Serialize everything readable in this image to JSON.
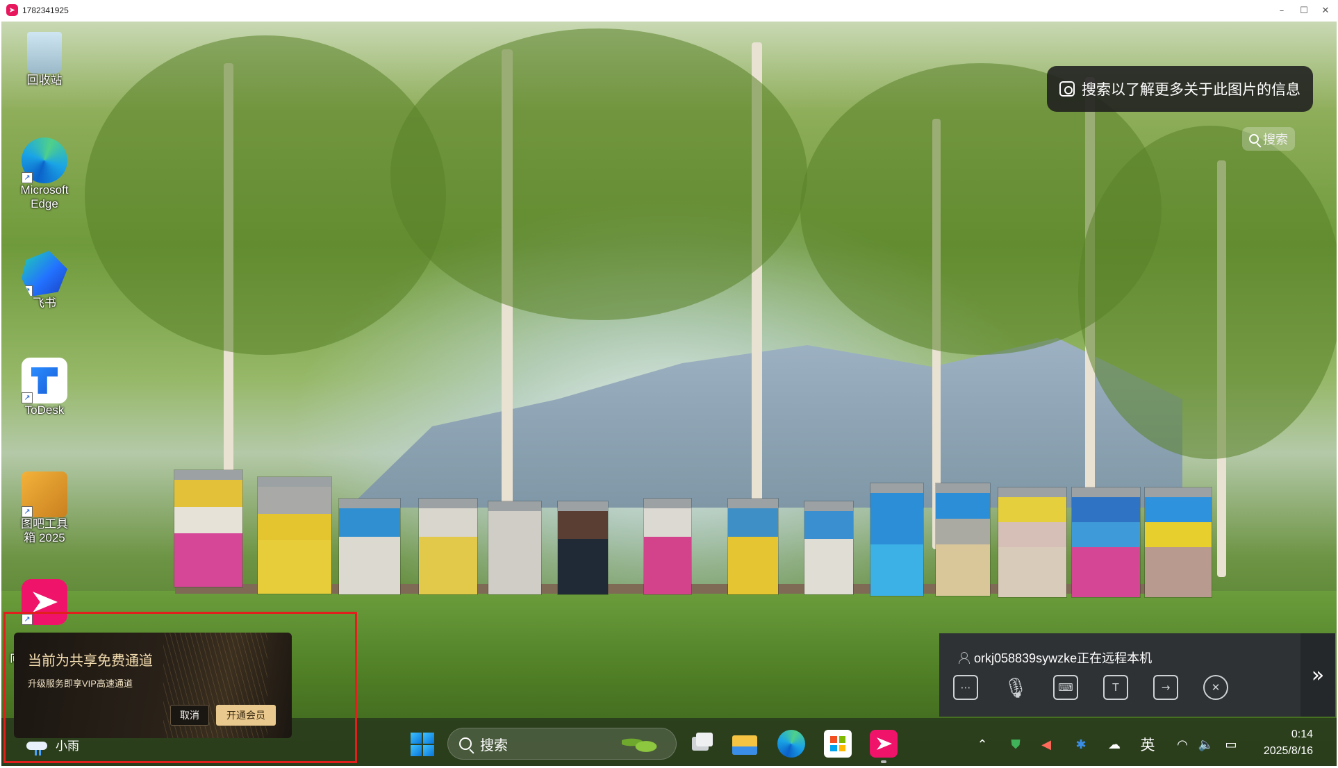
{
  "window": {
    "title": "1782341925",
    "controls": [
      "minimize-icon",
      "maximize-icon",
      "close-icon"
    ]
  },
  "desktop": {
    "icons": [
      {
        "label": "回收站",
        "icon": "recycle-bin-icon"
      },
      {
        "label": "Microsoft Edge",
        "icon": "edge-icon"
      },
      {
        "label": "飞书",
        "icon": "feishu-icon"
      },
      {
        "label": "ToDesk",
        "icon": "todesk-icon"
      },
      {
        "label": "图吧工具箱 2025",
        "icon": "toolbox-icon"
      },
      {
        "label": "向",
        "icon": "app-icon"
      }
    ],
    "visual_search": {
      "label": "搜索以了解更多关于此图片的信息",
      "icon": "visual-search-icon"
    },
    "search_chip": "搜索"
  },
  "remote_panel": {
    "user_text": "orkj058839sywzke正在远程本机",
    "tools": [
      "chat-icon",
      "microphone-icon",
      "keyboard-icon",
      "text-icon",
      "file-transfer-icon",
      "close-session-icon"
    ],
    "collapse_icon": "double-chevron-right-icon"
  },
  "vip_popup": {
    "title": "当前为共享免费通道",
    "subtitle": "升级服务即享VIP高速通道",
    "cancel_label": "取消",
    "join_label": "开通会员",
    "accent": "#e9c98e"
  },
  "taskbar": {
    "weather_label": "小雨",
    "search_placeholder": "搜索",
    "apps": [
      "task-view-icon",
      "file-explorer-icon",
      "edge-icon",
      "store-icon",
      "todesk-app-icon"
    ],
    "tray": {
      "language": "英",
      "time": "0:14",
      "date": "2025/8/16"
    }
  },
  "annotation": {
    "highlight_color": "#e1201d"
  }
}
